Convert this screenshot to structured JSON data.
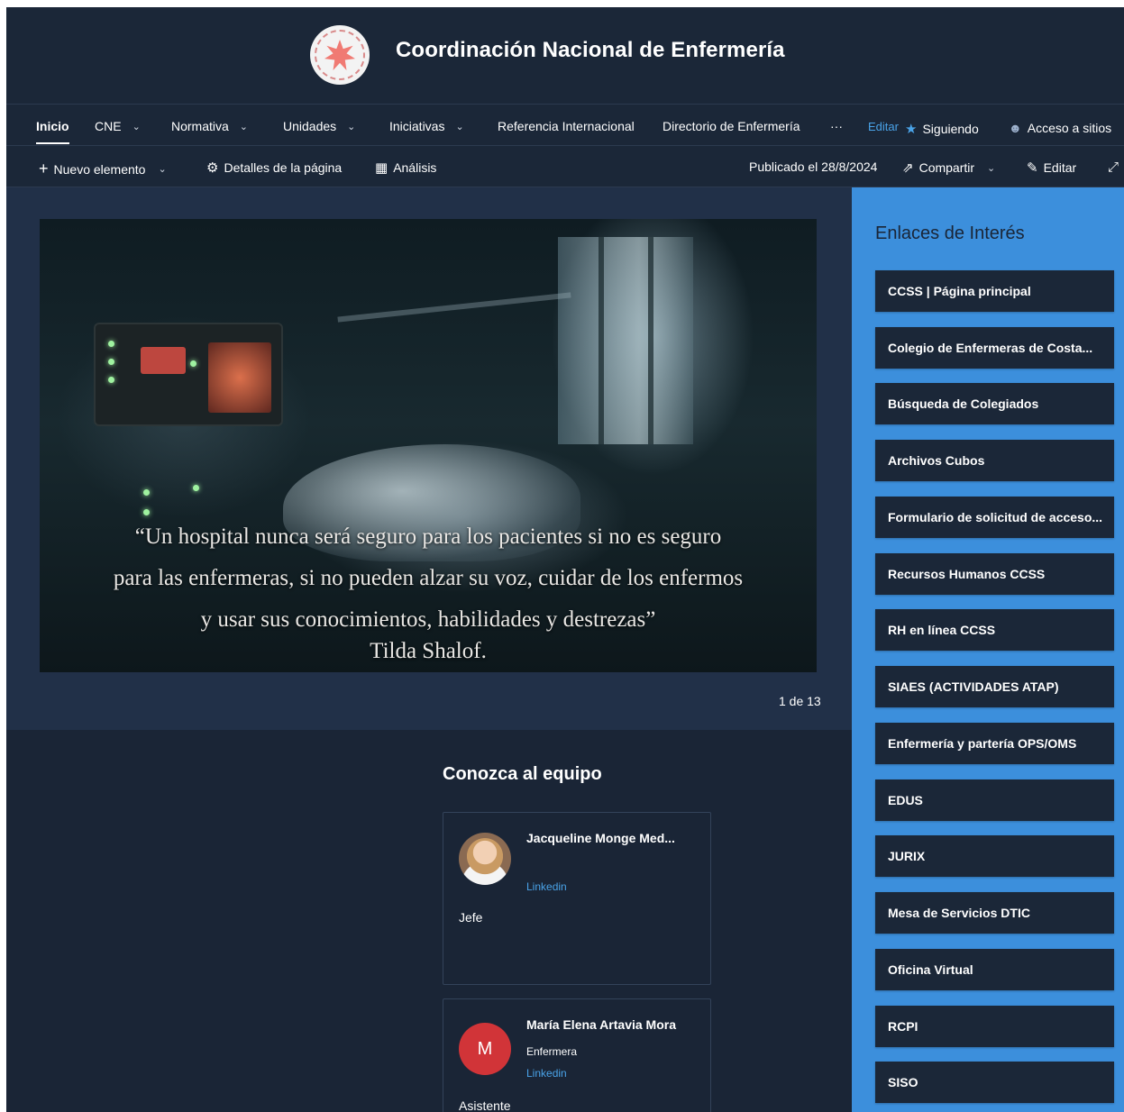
{
  "site": {
    "title": "Coordinación Nacional de Enfermería"
  },
  "nav": {
    "items": [
      {
        "label": "Inicio",
        "dropdown": false,
        "active": true
      },
      {
        "label": "CNE",
        "dropdown": true
      },
      {
        "label": "Normativa",
        "dropdown": true
      },
      {
        "label": "Unidades",
        "dropdown": true
      },
      {
        "label": "Iniciativas",
        "dropdown": true
      },
      {
        "label": "Referencia Internacional",
        "dropdown": false
      },
      {
        "label": "Directorio de Enfermería",
        "dropdown": false
      }
    ],
    "more": "···",
    "edit": "Editar",
    "following": "Siguiendo",
    "access": "Acceso a sitios"
  },
  "cmdbar": {
    "new_item": "Nuevo elemento",
    "page_details": "Detalles de la página",
    "analytics": "Análisis",
    "published": "Publicado el 28/8/2024",
    "share": "Compartir",
    "edit": "Editar"
  },
  "hero": {
    "quote_lines": [
      "“Un hospital nunca será seguro para los pacientes si no es seguro",
      "para las enfermeras, si no pueden alzar su voz, cuidar de los enfermos",
      "y usar sus conocimientos, habilidades y destrezas”"
    ],
    "author": "Tilda Shalof.",
    "pager": "1 de 13"
  },
  "team": {
    "title": "Conozca al equipo",
    "members": [
      {
        "name": "Jacqueline Monge Med...",
        "subtitle": "",
        "link": "Linkedin",
        "role": "Jefe",
        "initial": ""
      },
      {
        "name": "María Elena Artavia Mora",
        "subtitle": "Enfermera",
        "link": "Linkedin",
        "role": "Asistente",
        "initial": "M"
      }
    ]
  },
  "links": {
    "title": "Enlaces de Interés",
    "items": [
      "CCSS | Página principal",
      "Colegio de Enfermeras de Costa...",
      "Búsqueda de Colegiados",
      "Archivos Cubos",
      "Formulario de solicitud de acceso...",
      "Recursos Humanos CCSS",
      "RH en línea CCSS",
      "SIAES (ACTIVIDADES ATAP)",
      "Enfermería y partería OPS/OMS",
      "EDUS",
      "JURIX",
      "Mesa de Servicios DTIC",
      "Oficina Virtual",
      "RCPI",
      "SISO"
    ]
  },
  "colors": {
    "page_bg": "#1a2536",
    "header_bg": "#1b2738",
    "hero_section_bg": "#213048",
    "links_panel_bg": "#3c8fdc",
    "accent": "#4aa3e8",
    "avatar_initial_bg": "#d13438"
  },
  "icons": {
    "logo": "star-seal-logo",
    "chevron": "chevron-down-icon",
    "plus": "plus-icon",
    "gear": "gear-icon",
    "analytics": "chart-icon",
    "share": "share-icon",
    "pencil": "pencil-icon",
    "expand": "expand-icon",
    "star": "star-icon",
    "people": "people-icon"
  }
}
